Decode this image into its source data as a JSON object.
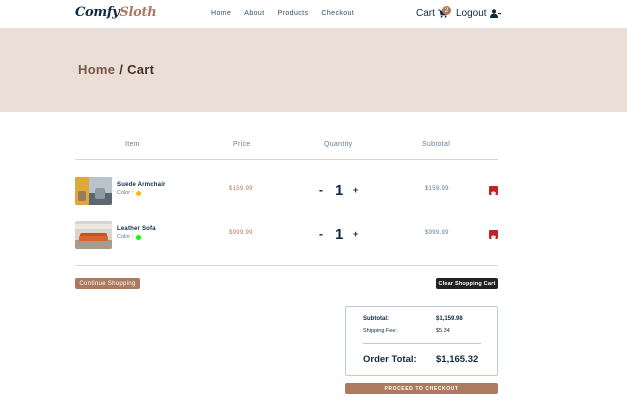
{
  "brand": {
    "name_part1": "Comfy",
    "name_part2": "Sloth",
    "accent": "#ab7a5f"
  },
  "nav": {
    "links": [
      "Home",
      "About",
      "Products",
      "Checkout"
    ]
  },
  "header": {
    "cart_label": "Cart",
    "cart_count": "2",
    "logout_label": "Logout"
  },
  "hero": {
    "home_link": "Home",
    "separator": " / ",
    "current": "Cart"
  },
  "table": {
    "columns": [
      "Item",
      "Price",
      "Quantity",
      "Subtotal"
    ],
    "items": [
      {
        "name": "Suede Armchair",
        "color_label": "Color :",
        "color": "#ffb900",
        "price": "$159.99",
        "quantity": "1",
        "minus": "-",
        "plus": "+",
        "subtotal": "$159.99",
        "icon": "trash-icon"
      },
      {
        "name": "Leather Sofa",
        "color_label": "Color :",
        "color": "#00ff00",
        "price": "$999.99",
        "quantity": "1",
        "minus": "-",
        "plus": "+",
        "subtotal": "$999.99",
        "icon": "trash-icon"
      }
    ]
  },
  "actions": {
    "continue_label": "Continue Shopping",
    "clear_label": "Clear Shopping Cart"
  },
  "totals": {
    "subtotal_label": "Subtotal:",
    "subtotal_value": "$1,159.98",
    "shipping_label": "Shipping Fee:",
    "shipping_value": "$5.34",
    "order_label": "Order Total:",
    "order_value": "$1,165.32"
  },
  "checkout_label": "PROCEED TO CHECKOUT"
}
